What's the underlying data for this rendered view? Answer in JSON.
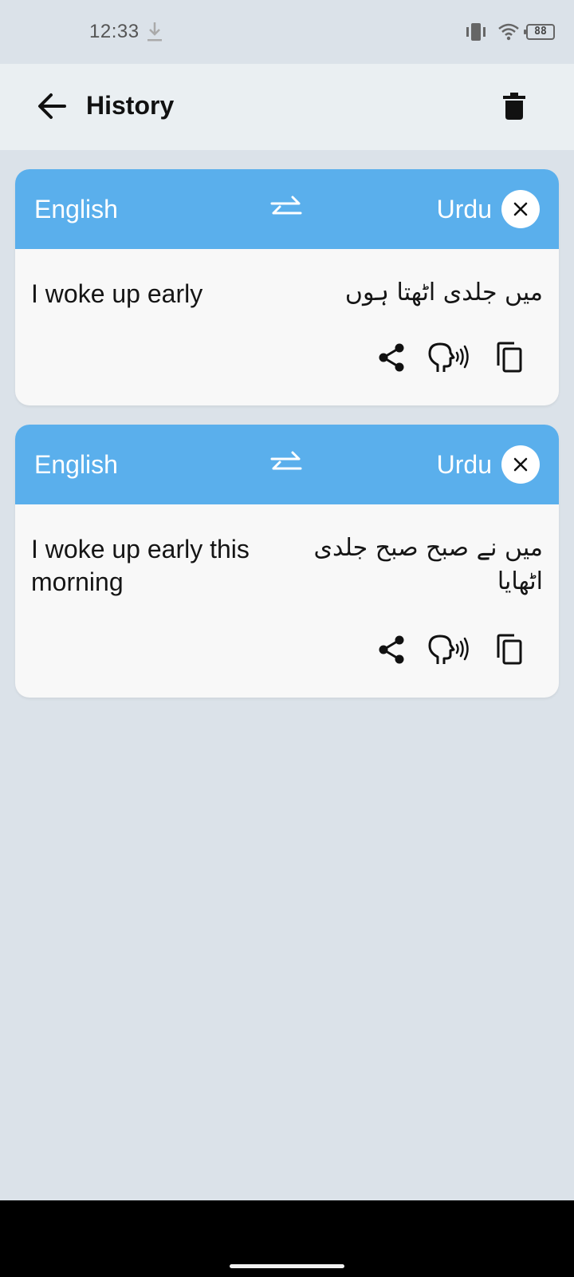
{
  "status_bar": {
    "time": "12:33",
    "battery": "88",
    "icons": [
      "download-icon",
      "vibrate-icon",
      "wifi-icon",
      "battery-icon"
    ]
  },
  "app_bar": {
    "title": "History",
    "back_icon": "arrow-back-icon",
    "delete_icon": "trash-icon"
  },
  "history": [
    {
      "source_lang": "English",
      "target_lang": "Urdu",
      "source_text": "I woke up early",
      "target_text": "میں جلدی اٹھتا ہوں"
    },
    {
      "source_lang": "English",
      "target_lang": "Urdu",
      "source_text": "I woke up early this morning",
      "target_text": "میں نے صبح صبح جلدی اٹھایا"
    }
  ],
  "card_icons": [
    "close-icon",
    "swap-icon",
    "share-icon",
    "speak-icon",
    "copy-icon"
  ],
  "colors": {
    "background": "#dbe2e9",
    "app_bar": "#eaeff2",
    "card_header": "#5aafec",
    "card_body": "#f8f8f8"
  }
}
